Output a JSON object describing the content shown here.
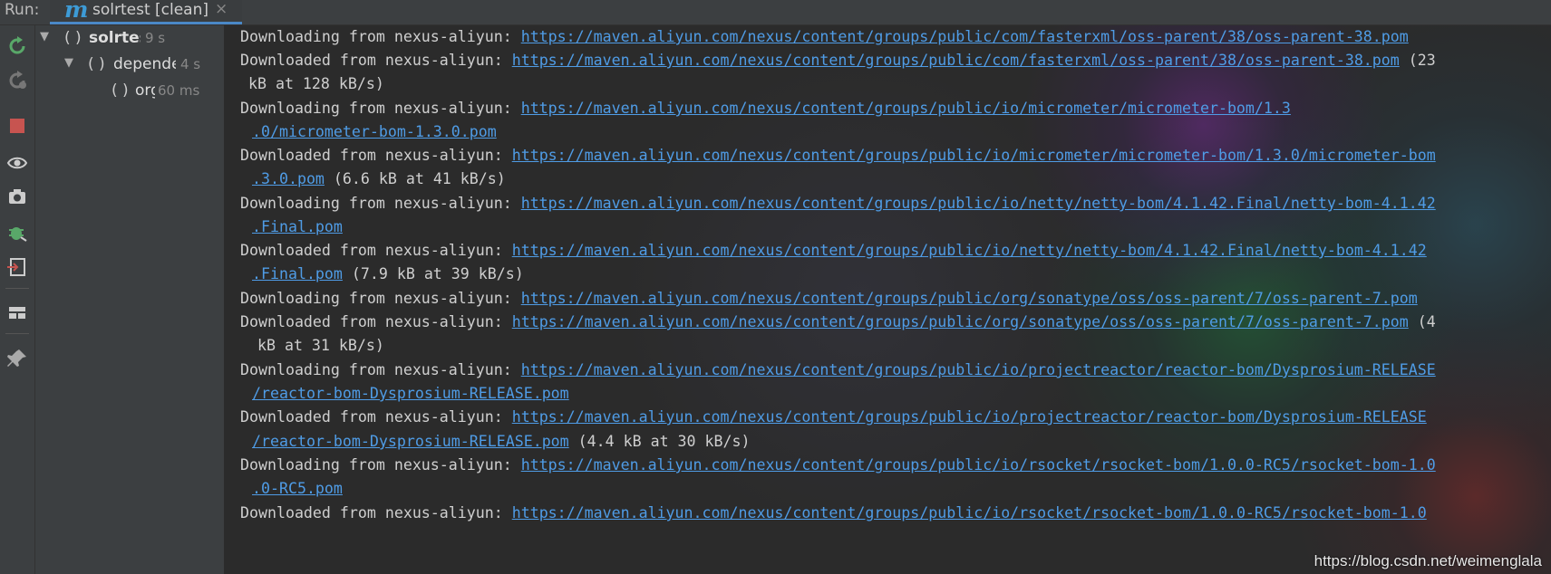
{
  "run_bar": {
    "label": "Run:",
    "tab_title": "solrtest [clean]",
    "tab_icon": "maven-icon",
    "tab_close": "×"
  },
  "toolbar": {
    "icons": [
      "rerun-icon",
      "rerun-failed-icon",
      "stop-icon",
      "show-icon",
      "screenshot-icon",
      "debug-icon",
      "exit-icon",
      "layout-icon",
      "pin-icon"
    ]
  },
  "tree": [
    {
      "label": "solrtest [clea",
      "time": "9 s",
      "expanded": true
    },
    {
      "label": "depende",
      "time": "4 s",
      "expanded": true
    },
    {
      "label": "org",
      "time": "60 ms"
    }
  ],
  "console": {
    "lines": [
      {
        "prefix": "Downloading from nexus-aliyun: ",
        "link": "https://maven.aliyun.com/nexus/content/groups/public/com/fasterxml/oss-parent/38/oss-parent-38.pom",
        "suffix": ""
      },
      {
        "prefix": "Downloaded from nexus-aliyun: ",
        "link": "https://maven.aliyun.com/nexus/content/groups/public/com/fasterxml/oss-parent/38/oss-parent-38.pom",
        "suffix": " (23"
      },
      {
        "cont": " kB at 128 kB/s)"
      },
      {
        "prefix": "Downloading from nexus-aliyun: ",
        "link": "https://maven.aliyun.com/nexus/content/groups/public/io/micrometer/micrometer-bom/1.3",
        "suffix": ""
      },
      {
        "cont_link": ".0/micrometer-bom-1.3.0.pom",
        "cont_suffix": ""
      },
      {
        "prefix": "Downloaded from nexus-aliyun: ",
        "link": "https://maven.aliyun.com/nexus/content/groups/public/io/micrometer/micrometer-bom/1.3.0/micrometer-bom",
        "suffix": ""
      },
      {
        "cont_link": ".3.0.pom",
        "cont_suffix": " (6.6 kB at 41 kB/s)"
      },
      {
        "prefix": "Downloading from nexus-aliyun: ",
        "link": "https://maven.aliyun.com/nexus/content/groups/public/io/netty/netty-bom/4.1.42.Final/netty-bom-4.1.42",
        "suffix": ""
      },
      {
        "cont_link": ".Final.pom",
        "cont_suffix": ""
      },
      {
        "prefix": "Downloaded from nexus-aliyun: ",
        "link": "https://maven.aliyun.com/nexus/content/groups/public/io/netty/netty-bom/4.1.42.Final/netty-bom-4.1.42",
        "suffix": ""
      },
      {
        "cont_link": ".Final.pom",
        "cont_suffix": " (7.9 kB at 39 kB/s)"
      },
      {
        "prefix": "Downloading from nexus-aliyun: ",
        "link": "https://maven.aliyun.com/nexus/content/groups/public/org/sonatype/oss/oss-parent/7/oss-parent-7.pom",
        "suffix": ""
      },
      {
        "prefix": "Downloaded from nexus-aliyun: ",
        "link": "https://maven.aliyun.com/nexus/content/groups/public/org/sonatype/oss/oss-parent/7/oss-parent-7.pom",
        "suffix": " (4"
      },
      {
        "cont": "  kB at 31 kB/s)"
      },
      {
        "prefix": "Downloading from nexus-aliyun: ",
        "link": "https://maven.aliyun.com/nexus/content/groups/public/io/projectreactor/reactor-bom/Dysprosium-RELEASE",
        "suffix": ""
      },
      {
        "cont_link": "/reactor-bom-Dysprosium-RELEASE.pom",
        "cont_suffix": ""
      },
      {
        "prefix": "Downloaded from nexus-aliyun: ",
        "link": "https://maven.aliyun.com/nexus/content/groups/public/io/projectreactor/reactor-bom/Dysprosium-RELEASE",
        "suffix": ""
      },
      {
        "cont_link": "/reactor-bom-Dysprosium-RELEASE.pom",
        "cont_suffix": " (4.4 kB at 30 kB/s)"
      },
      {
        "prefix": "Downloading from nexus-aliyun: ",
        "link": "https://maven.aliyun.com/nexus/content/groups/public/io/rsocket/rsocket-bom/1.0.0-RC5/rsocket-bom-1.0",
        "suffix": ""
      },
      {
        "cont_link": ".0-RC5.pom",
        "cont_suffix": ""
      },
      {
        "prefix": "Downloaded from nexus-aliyun: ",
        "link": "https://maven.aliyun.com/nexus/content/groups/public/io/rsocket/rsocket-bom/1.0.0-RC5/rsocket-bom-1.0",
        "suffix": ""
      }
    ]
  },
  "watermark": "https://blog.csdn.net/weimenglala"
}
